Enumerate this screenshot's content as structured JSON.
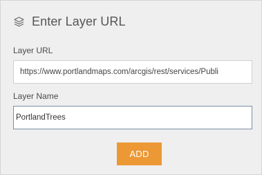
{
  "panel": {
    "title": "Enter Layer URL",
    "title_icon": "layers-icon"
  },
  "fields": {
    "layer_url": {
      "label": "Layer URL",
      "value": "https://www.portlandmaps.com/arcgis/rest/services/Publi"
    },
    "layer_name": {
      "label": "Layer Name",
      "value": "PortlandTrees"
    }
  },
  "actions": {
    "add_label": "ADD"
  },
  "colors": {
    "accent": "#ec9834",
    "panel_background": "#efefef",
    "focused_border": "#7a8fa8"
  }
}
